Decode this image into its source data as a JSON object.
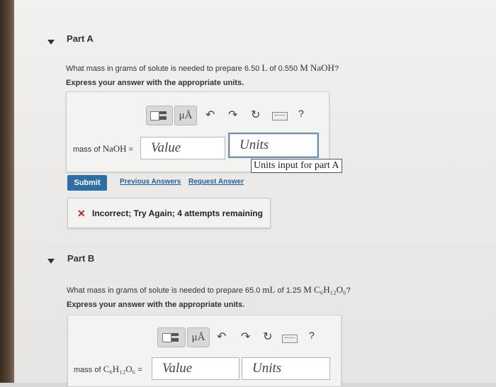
{
  "partA": {
    "title": "Part A",
    "question_prefix": "What mass in grams of solute is needed to prepare 6.50 ",
    "question_unit": "L",
    "question_mid": " of 0.550 ",
    "question_conc": "M NaOH",
    "question_end": "?",
    "instruction": "Express your answer with the appropriate units.",
    "toolbar": {
      "mu_label": "μÅ",
      "help_label": "?"
    },
    "answer_label_prefix": "mass of ",
    "answer_label_formula": "NaOH",
    "answer_label_eq": " =",
    "value_placeholder": "Value",
    "units_placeholder": "Units",
    "units_tooltip": "Units input for part A",
    "submit_label": "Submit",
    "previous_answers_label": "Previous Answers",
    "request_answer_label": "Request Answer",
    "feedback_icon": "✕",
    "feedback_text": "Incorrect; Try Again; 4 attempts remaining"
  },
  "partB": {
    "title": "Part B",
    "question_prefix": "What mass in grams of solute is needed to prepare 65.0 ",
    "question_unit": "mL",
    "question_mid": " of 1.25 ",
    "question_conc": "M C₆H₁₂O₆",
    "question_end": "?",
    "instruction": "Express your answer with the appropriate units.",
    "toolbar": {
      "mu_label": "μÅ",
      "help_label": "?"
    },
    "answer_label_prefix": "mass of ",
    "answer_label_formula": "C₆H₁₂O₆",
    "answer_label_eq": " =",
    "value_placeholder": "Value",
    "units_placeholder": "Units"
  },
  "colors": {
    "submit": "#2f6ea5",
    "link": "#1f5f99",
    "error": "#c3232d",
    "focus": "#6f8fb0"
  }
}
